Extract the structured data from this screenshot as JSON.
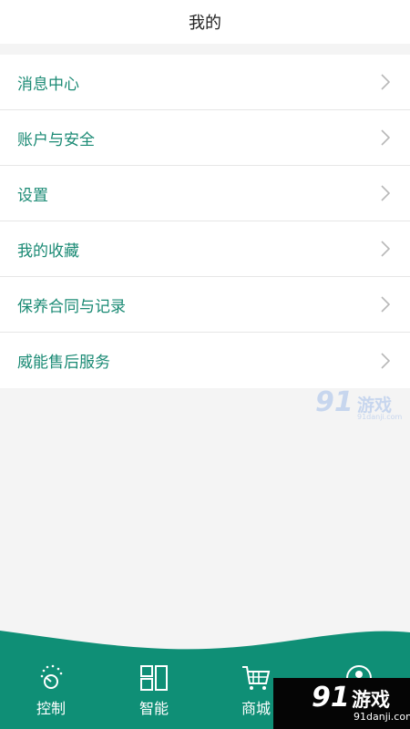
{
  "header": {
    "title": "我的"
  },
  "menu": {
    "items": [
      {
        "label": "消息中心"
      },
      {
        "label": "账户与安全"
      },
      {
        "label": "设置"
      },
      {
        "label": "我的收藏"
      },
      {
        "label": "保养合同与记录"
      },
      {
        "label": "威能售后服务"
      }
    ]
  },
  "tabbar": {
    "tabs": [
      {
        "label": "控制",
        "icon": "control-dial-icon"
      },
      {
        "label": "智能",
        "icon": "smart-grid-icon"
      },
      {
        "label": "商城",
        "icon": "shopping-cart-icon"
      },
      {
        "label": "",
        "icon": "user-profile-icon"
      }
    ]
  },
  "watermark": {
    "brand": "91",
    "name": "游戏",
    "site": "91danji.com"
  },
  "colors": {
    "accent": "#1a8a74",
    "tabbar": "#0f8f76",
    "background": "#f4f4f4"
  }
}
